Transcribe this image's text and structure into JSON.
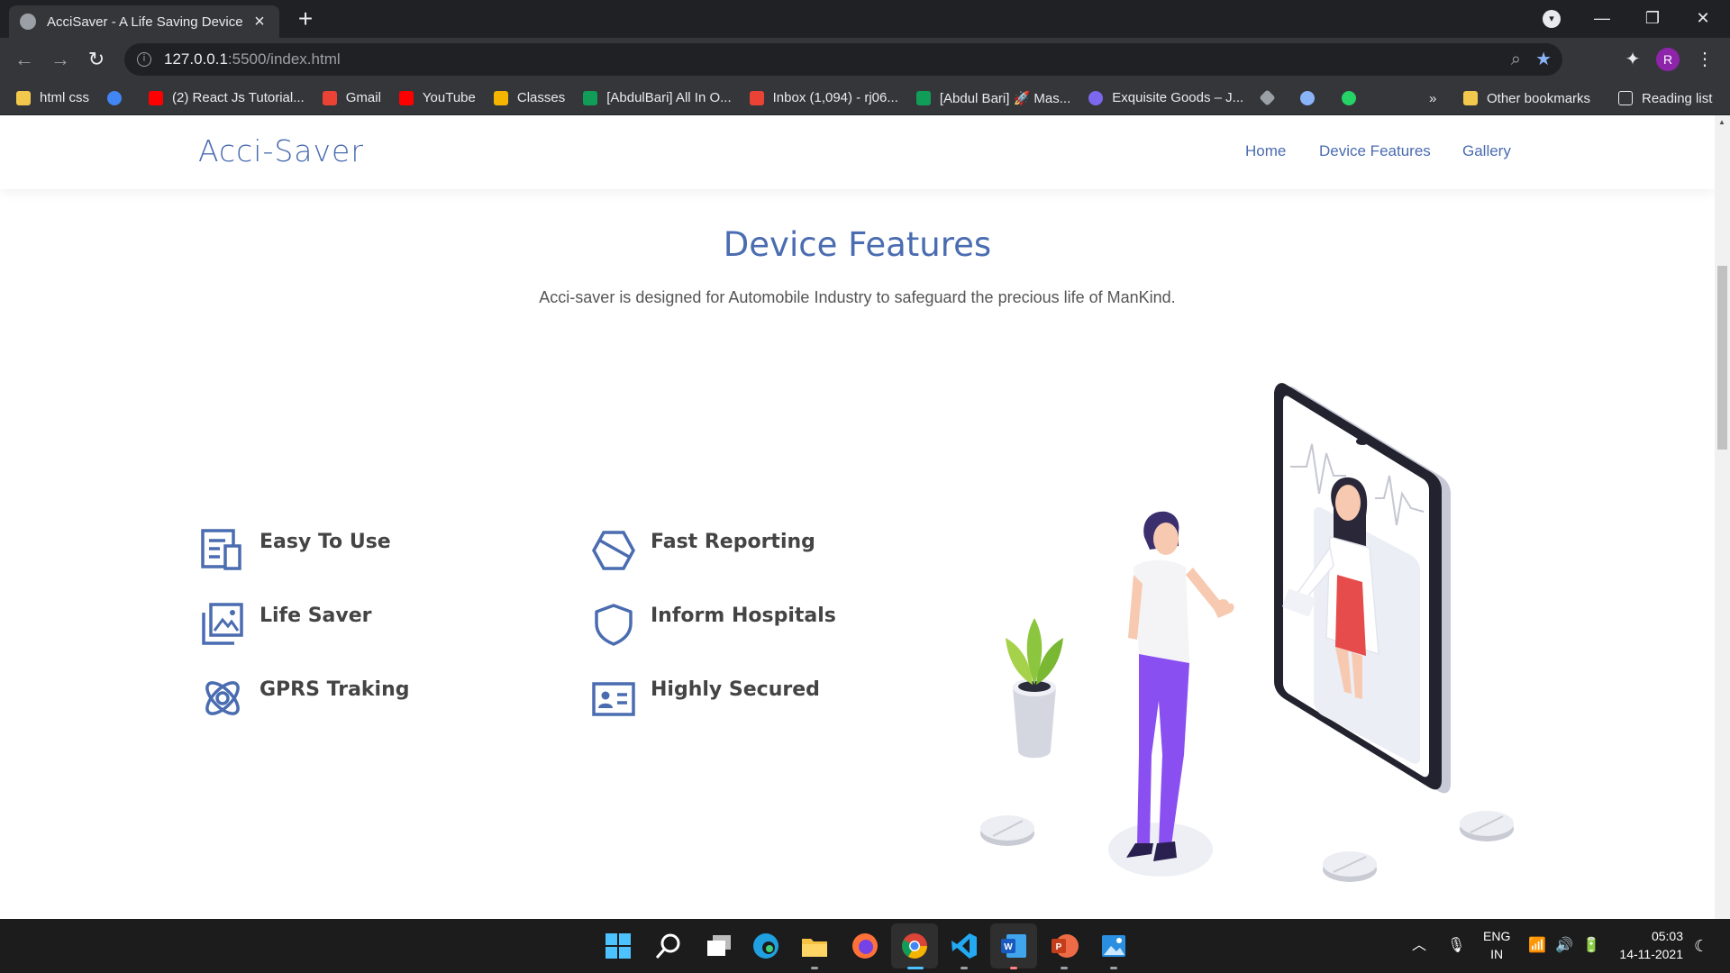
{
  "browser": {
    "tab_title": "AcciSaver - A Life Saving Device",
    "url_host": "127.0.0.1",
    "url_path": ":5500/index.html",
    "bookmarks": [
      {
        "label": "html css",
        "color": "#f2c94c"
      },
      {
        "label": "",
        "color": "#4285f4"
      },
      {
        "label": "(2) React Js Tutorial...",
        "color": "#ff0000"
      },
      {
        "label": "Gmail",
        "color": "#ea4335"
      },
      {
        "label": "YouTube",
        "color": "#ff0000"
      },
      {
        "label": "Classes",
        "color": "#f4b400"
      },
      {
        "label": "[AbdulBari] All In O...",
        "color": "#0f9d58"
      },
      {
        "label": "Inbox (1,094) - rj06...",
        "color": "#ea4335"
      },
      {
        "label": "[Abdul Bari] 🚀 Mas...",
        "color": "#0f9d58"
      },
      {
        "label": "Exquisite Goods – J...",
        "color": "#7b68ee"
      }
    ],
    "more_bookmarks": "»",
    "other_bookmarks": "Other bookmarks",
    "reading_list": "Reading list",
    "profile_initial": "R"
  },
  "site": {
    "logo": "Acci-Saver",
    "nav": {
      "home": "Home",
      "features": "Device Features",
      "gallery": "Gallery"
    }
  },
  "section": {
    "title": "Device Features",
    "subtitle": "Acci-saver is designed for Automobile Industry to safeguard the precious life of ManKind."
  },
  "features": [
    {
      "label": "Easy To Use",
      "icon": "document-icon"
    },
    {
      "label": "Life Saver",
      "icon": "images-icon"
    },
    {
      "label": "GPRS Traking",
      "icon": "atom-icon"
    },
    {
      "label": "Fast Reporting",
      "icon": "hexagon-icon"
    },
    {
      "label": "Inform Hospitals",
      "icon": "shield-icon"
    },
    {
      "label": "Highly Secured",
      "icon": "id-card-icon"
    }
  ],
  "taskbar": {
    "lang_top": "ENG",
    "lang_bottom": "IN",
    "time": "05:03",
    "date": "14-11-2021"
  },
  "colors": {
    "accent": "#4a6cb0",
    "chrome_dark": "#202124",
    "chrome": "#35363a"
  }
}
